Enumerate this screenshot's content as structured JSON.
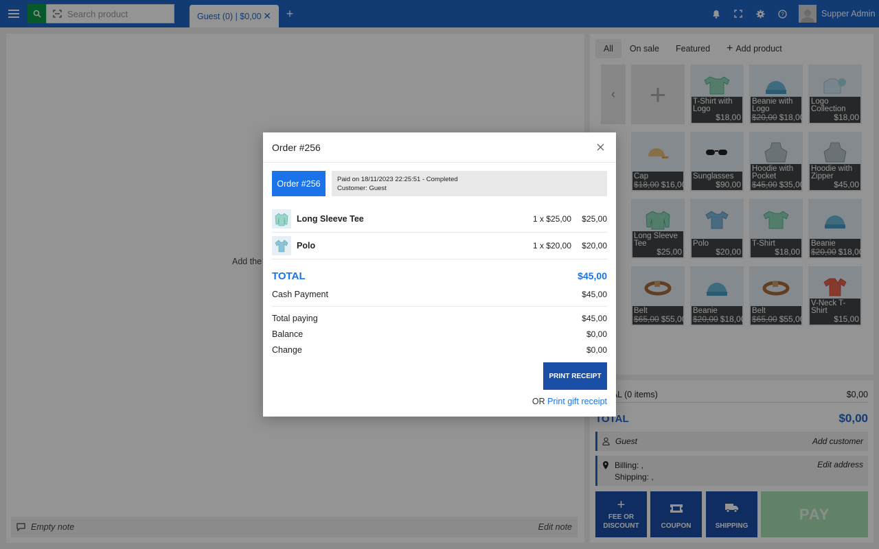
{
  "topbar": {
    "search_placeholder": "Search product",
    "tab_label": "Guest (0) | $0,00",
    "tab_close": "✕",
    "add_tab": "+",
    "user_name": "Supper Admin"
  },
  "left": {
    "hint": "Add the",
    "note": "Empty note",
    "edit_note": "Edit note"
  },
  "products": {
    "filters": [
      "All",
      "On sale",
      "Featured",
      "Add product"
    ],
    "items": [
      {
        "name": "T-Shirt with Logo",
        "old": "",
        "price": "$18,00",
        "icon": "tshirt-icon"
      },
      {
        "name": "Beanie with Logo",
        "old": "$20,00",
        "price": "$18,00",
        "icon": "beanie-icon"
      },
      {
        "name": "Logo Collection",
        "old": "",
        "price": "$18,00",
        "icon": "collection-icon"
      },
      {
        "name": "Cap",
        "old": "$18,00",
        "price": "$16,00",
        "icon": "cap-icon"
      },
      {
        "name": "Sunglasses",
        "old": "",
        "price": "$90,00",
        "icon": "sunglasses-icon"
      },
      {
        "name": "Hoodie with Pocket",
        "old": "$45,00",
        "price": "$35,00",
        "icon": "hoodie-icon"
      },
      {
        "name": "Hoodie with Zipper",
        "old": "",
        "price": "$45,00",
        "icon": "hoodie-icon"
      },
      {
        "name": "Long Sleeve Tee",
        "old": "",
        "price": "$25,00",
        "icon": "longsleeve-icon"
      },
      {
        "name": "Polo",
        "old": "",
        "price": "$20,00",
        "icon": "polo-icon"
      },
      {
        "name": "T-Shirt",
        "old": "",
        "price": "$18,00",
        "icon": "tshirt-icon"
      },
      {
        "name": "Beanie",
        "old": "$20,00",
        "price": "$18,00",
        "icon": "beanie-icon"
      },
      {
        "name": "Belt",
        "old": "$65,00",
        "price": "$55,00",
        "icon": "belt-icon"
      },
      {
        "name": "Beanie",
        "old": "$20,00",
        "price": "$18,00",
        "icon": "beanie-icon"
      },
      {
        "name": "Belt",
        "old": "$65,00",
        "price": "$55,00",
        "icon": "belt-icon"
      },
      {
        "name": "V-Neck T-Shirt",
        "old": "",
        "price": "$15,00",
        "icon": "vneck-icon"
      }
    ]
  },
  "cart": {
    "subtotal_label": "TOTAL (0 items)",
    "subtotal_value": "$0,00",
    "total_label": "TOTAL",
    "total_value": "$0,00",
    "customer": "Guest",
    "add_customer": "Add customer",
    "billing": "Billing: ,",
    "shipping": "Shipping: ,",
    "edit_address": "Edit address",
    "buttons": {
      "fee": "FEE OR DISCOUNT",
      "coupon": "COUPON",
      "shipping": "SHIPPING",
      "pay": "PAY"
    }
  },
  "modal": {
    "title": "Order #256",
    "badge": "Order #256",
    "paid_line": "Paid on 18/11/2023 22:25:51 - Completed",
    "customer_line": "Customer: Guest",
    "items": [
      {
        "name": "Long Sleeve Tee",
        "qty": "1 x $25,00",
        "amount": "$25,00"
      },
      {
        "name": "Polo",
        "qty": "1 x $20,00",
        "amount": "$20,00"
      }
    ],
    "total_label": "TOTAL",
    "total_value": "$45,00",
    "cash_label": "Cash Payment",
    "cash_value": "$45,00",
    "total_paying_label": "Total paying",
    "total_paying_value": "$45,00",
    "balance_label": "Balance",
    "balance_value": "$0,00",
    "change_label": "Change",
    "change_value": "$0,00",
    "print_receipt": "PRINT RECEIPT",
    "or": "OR",
    "print_gift": "Print gift receipt"
  },
  "colors": {
    "brand_blue": "#1f66c9",
    "dark_blue": "#1a4fa8",
    "search_green": "#0d9a4a",
    "pay_green": "#a8e0b4"
  }
}
